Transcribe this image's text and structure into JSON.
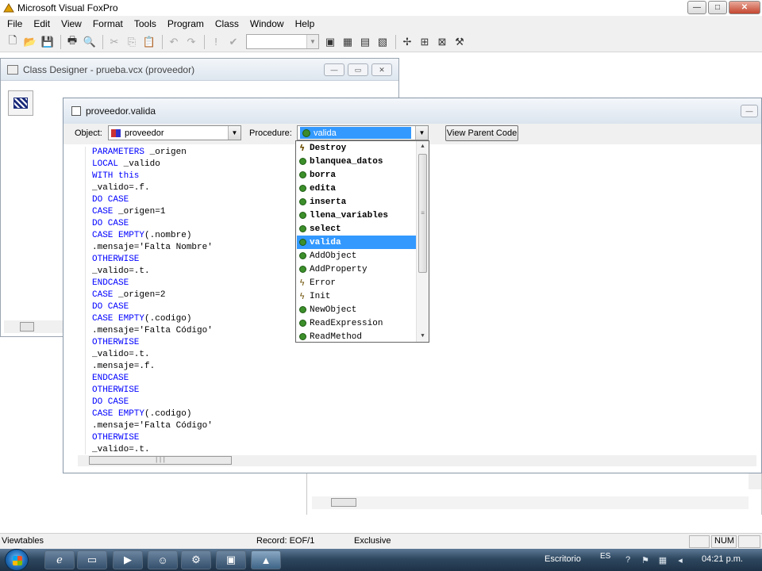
{
  "app": {
    "title": "Microsoft Visual FoxPro",
    "window_controls": {
      "minimize": "—",
      "maximize": "□",
      "close": "✕"
    }
  },
  "menu": [
    "File",
    "Edit",
    "View",
    "Format",
    "Tools",
    "Program",
    "Class",
    "Window",
    "Help"
  ],
  "toolbar": {
    "icons": [
      "new-file-icon",
      "open-folder-icon",
      "save-icon",
      "print-icon",
      "print-preview-icon",
      "cut-icon",
      "copy-icon",
      "paste-icon",
      "undo-icon",
      "redo-icon",
      "run-icon",
      "modify-icon",
      "form-icon",
      "class-designer-icon",
      "properties-icon",
      "code-window-icon",
      "data-session-icon",
      "form-layout-icon",
      "wizard-icon",
      "tools-icon"
    ],
    "combo_value": ""
  },
  "class_designer": {
    "title": "Class Designer - prueba.vcx (proveedor)"
  },
  "code_window": {
    "title": "proveedor.valida",
    "object_label": "Object:",
    "object_value": "proveedor",
    "procedure_label": "Procedure:",
    "procedure_value": "valida",
    "view_parent_button": "View Parent Code",
    "lines": [
      [
        {
          "t": "PARAMETERS",
          "k": true
        },
        {
          "t": " _origen",
          "k": false
        }
      ],
      [
        {
          "t": "LOCAL",
          "k": true
        },
        {
          "t": " _valido",
          "k": false
        }
      ],
      [
        {
          "t": "WITH this",
          "k": true
        }
      ],
      [
        {
          "t": "_valido=.f.",
          "k": false
        }
      ],
      [
        {
          "t": "DO CASE",
          "k": true
        }
      ],
      [
        {
          "t": "CASE",
          "k": true
        },
        {
          "t": " _origen=1",
          "k": false
        }
      ],
      [
        {
          "t": "DO CASE",
          "k": true
        }
      ],
      [
        {
          "t": "CASE EMPTY",
          "k": true
        },
        {
          "t": "(.nombre)",
          "k": false
        }
      ],
      [
        {
          "t": ".mensaje='Falta Nombre'",
          "k": false
        }
      ],
      [
        {
          "t": "OTHERWISE",
          "k": true
        }
      ],
      [
        {
          "t": "_valido=.t.",
          "k": false
        }
      ],
      [
        {
          "t": "ENDCASE",
          "k": true
        }
      ],
      [
        {
          "t": "CASE",
          "k": true
        },
        {
          "t": " _origen=2",
          "k": false
        }
      ],
      [
        {
          "t": "DO CASE",
          "k": true
        }
      ],
      [
        {
          "t": "CASE EMPTY",
          "k": true
        },
        {
          "t": "(.codigo)",
          "k": false
        }
      ],
      [
        {
          "t": ".mensaje='Falta Código'",
          "k": false
        }
      ],
      [
        {
          "t": "OTHERWISE",
          "k": true
        }
      ],
      [
        {
          "t": "_valido=.t.",
          "k": false
        }
      ],
      [
        {
          "t": ".mensaje=.f.",
          "k": false
        }
      ],
      [
        {
          "t": "ENDCASE",
          "k": true
        }
      ],
      [
        {
          "t": "OTHERWISE",
          "k": true
        }
      ],
      [
        {
          "t": "DO CASE",
          "k": true
        }
      ],
      [
        {
          "t": "CASE EMPTY",
          "k": true
        },
        {
          "t": "(.codigo)",
          "k": false
        }
      ],
      [
        {
          "t": ".mensaje='Falta Código'",
          "k": false
        }
      ],
      [
        {
          "t": "OTHERWISE",
          "k": true
        }
      ],
      [
        {
          "t": "_valido=.t.",
          "k": false
        }
      ]
    ]
  },
  "procedure_dropdown": {
    "items": [
      {
        "label": "Destroy",
        "icon": "event-icon",
        "bold": true,
        "selected": false
      },
      {
        "label": "blanquea_datos",
        "icon": "method-icon",
        "bold": true,
        "selected": false
      },
      {
        "label": "borra",
        "icon": "method-icon",
        "bold": true,
        "selected": false
      },
      {
        "label": "edita",
        "icon": "method-icon",
        "bold": true,
        "selected": false
      },
      {
        "label": "inserta",
        "icon": "method-icon",
        "bold": true,
        "selected": false
      },
      {
        "label": "llena_variables",
        "icon": "method-icon",
        "bold": true,
        "selected": false
      },
      {
        "label": "select",
        "icon": "method-icon",
        "bold": true,
        "selected": false
      },
      {
        "label": "valida",
        "icon": "method-icon",
        "bold": true,
        "selected": true
      },
      {
        "label": "AddObject",
        "icon": "method-icon",
        "bold": false,
        "selected": false
      },
      {
        "label": "AddProperty",
        "icon": "method-icon",
        "bold": false,
        "selected": false
      },
      {
        "label": "Error",
        "icon": "event-icon",
        "bold": false,
        "selected": false
      },
      {
        "label": "Init",
        "icon": "event-icon",
        "bold": false,
        "selected": false
      },
      {
        "label": "NewObject",
        "icon": "method-icon",
        "bold": false,
        "selected": false
      },
      {
        "label": "ReadExpression",
        "icon": "method-icon",
        "bold": false,
        "selected": false
      },
      {
        "label": "ReadMethod",
        "icon": "method-icon",
        "bold": false,
        "selected": false
      }
    ]
  },
  "status_bar": {
    "left": "Viewtables",
    "record": "Record: EOF/1",
    "mode": "Exclusive",
    "num": "NUM"
  },
  "taskbar": {
    "desktop_label": "Escritorio",
    "language": "ES",
    "clock": "04:21 p.m.",
    "buttons": [
      "internet-explorer-icon",
      "explorer-icon",
      "media-player-icon",
      "messenger-icon",
      "network-tool-icon",
      "console-icon",
      "visual-foxpro-icon"
    ]
  }
}
